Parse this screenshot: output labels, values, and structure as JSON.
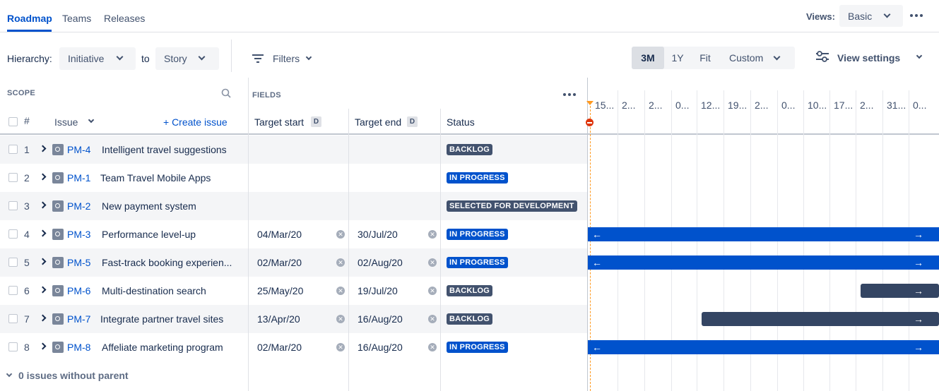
{
  "nav": {
    "tabs": [
      {
        "label": "Roadmap"
      },
      {
        "label": "Teams"
      },
      {
        "label": "Releases"
      }
    ],
    "views_label": "Views:",
    "views_value": "Basic"
  },
  "toolbar": {
    "hierarchy_label": "Hierarchy:",
    "hierarchy_from": "Initiative",
    "to_label": "to",
    "hierarchy_to": "Story",
    "filters_label": "Filters",
    "zoom": [
      {
        "label": "3M",
        "selected": true
      },
      {
        "label": "1Y",
        "selected": false
      },
      {
        "label": "Fit",
        "selected": false
      },
      {
        "label": "Custom",
        "selected": false
      }
    ],
    "view_settings_label": "View settings"
  },
  "scope": {
    "label": "SCOPE",
    "hash": "#",
    "issue_header": "Issue",
    "create_issue": "+ Create issue"
  },
  "fields": {
    "label": "FIELDS",
    "columns": [
      {
        "label": "Target start",
        "badge": "D"
      },
      {
        "label": "Target end",
        "badge": "D"
      },
      {
        "label": "Status"
      }
    ]
  },
  "timeline": {
    "ticks": [
      "15...",
      "2...",
      "2...",
      "0...",
      "12...",
      "19...",
      "2...",
      "0...",
      "10...",
      "17...",
      "2...",
      "31...",
      "0..."
    ]
  },
  "rows": [
    {
      "num": "1",
      "key": "PM-4",
      "summary": "Intelligent travel suggestions",
      "start": "",
      "end": "",
      "status": "BACKLOG",
      "status_color": "#42526E"
    },
    {
      "num": "2",
      "key": "PM-1",
      "summary": "Team Travel Mobile Apps",
      "start": "",
      "end": "",
      "status": "IN PROGRESS",
      "status_color": "#0052CC"
    },
    {
      "num": "3",
      "key": "PM-2",
      "summary": "New payment system",
      "start": "",
      "end": "",
      "status": "SELECTED FOR DEVELOPMENT",
      "status_color": "#42526E"
    },
    {
      "num": "4",
      "key": "PM-3",
      "summary": "Performance level-up",
      "start": "04/Mar/20",
      "end": "30/Jul/20",
      "status": "IN PROGRESS",
      "status_color": "#0052CC"
    },
    {
      "num": "5",
      "key": "PM-5",
      "summary": "Fast-track booking experien...",
      "start": "02/Mar/20",
      "end": "02/Aug/20",
      "status": "IN PROGRESS",
      "status_color": "#0052CC"
    },
    {
      "num": "6",
      "key": "PM-6",
      "summary": "Multi-destination search",
      "start": "25/May/20",
      "end": "19/Jul/20",
      "status": "BACKLOG",
      "status_color": "#42526E"
    },
    {
      "num": "7",
      "key": "PM-7",
      "summary": "Integrate partner travel sites",
      "start": "13/Apr/20",
      "end": "16/Aug/20",
      "status": "BACKLOG",
      "status_color": "#42526E"
    },
    {
      "num": "8",
      "key": "PM-8",
      "summary": "Affeliate marketing program",
      "start": "02/Mar/20",
      "end": "16/Aug/20",
      "status": "IN PROGRESS",
      "status_color": "#0052CC"
    }
  ],
  "footer": {
    "without_parent": "0 issues without parent"
  },
  "colors": {
    "accent": "#0052CC",
    "bar_in_progress": "#0052CC",
    "bar_backlog": "#344563"
  }
}
